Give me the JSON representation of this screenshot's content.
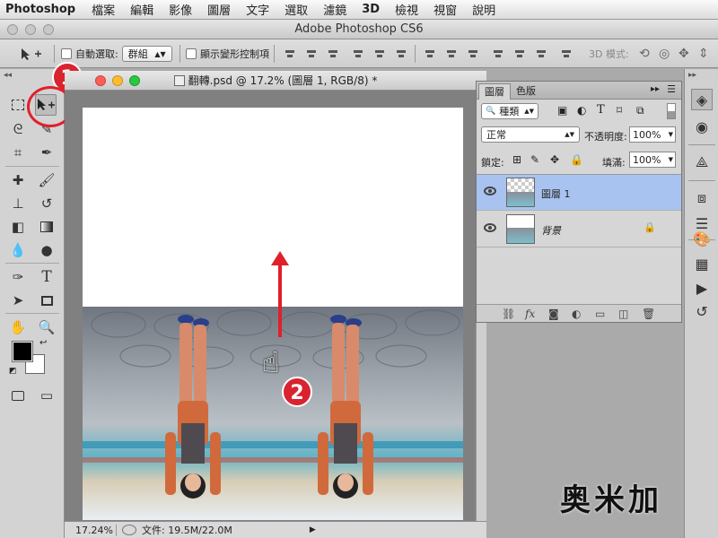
{
  "menubar": {
    "app": "Photoshop",
    "items": [
      "檔案",
      "編輯",
      "影像",
      "圖層",
      "文字",
      "選取",
      "濾鏡",
      "3D",
      "檢視",
      "視窗",
      "說明"
    ]
  },
  "app_title": "Adobe Photoshop CS6",
  "options_bar": {
    "auto_select_label": "自動選取:",
    "auto_select_value": "群組",
    "show_transform_label": "顯示變形控制項",
    "mode_3d_label": "3D 模式:"
  },
  "document": {
    "title": "翻轉.psd @ 17.2% (圖層 1, RGB/8) *",
    "zoom": "17.24%",
    "file_info": "文件: 19.5M/22.0M"
  },
  "layers_panel": {
    "tab_layers": "圖層",
    "tab_color": "色版",
    "filter_kind": "種類",
    "blend_mode": "正常",
    "opacity_label": "不透明度:",
    "opacity_value": "100%",
    "lock_label": "鎖定:",
    "fill_label": "填滿:",
    "fill_value": "100%",
    "layers": [
      {
        "name": "圖層 1",
        "selected": true,
        "visible": true,
        "locked": false
      },
      {
        "name": "背景",
        "selected": false,
        "visible": true,
        "locked": true
      }
    ]
  },
  "annotations": {
    "step1": "1",
    "step2": "2"
  },
  "watermark": "奥米加",
  "colors": {
    "selected_layer": "#a9c3f0",
    "badge": "#d9232f",
    "arrow": "#e0202a"
  }
}
